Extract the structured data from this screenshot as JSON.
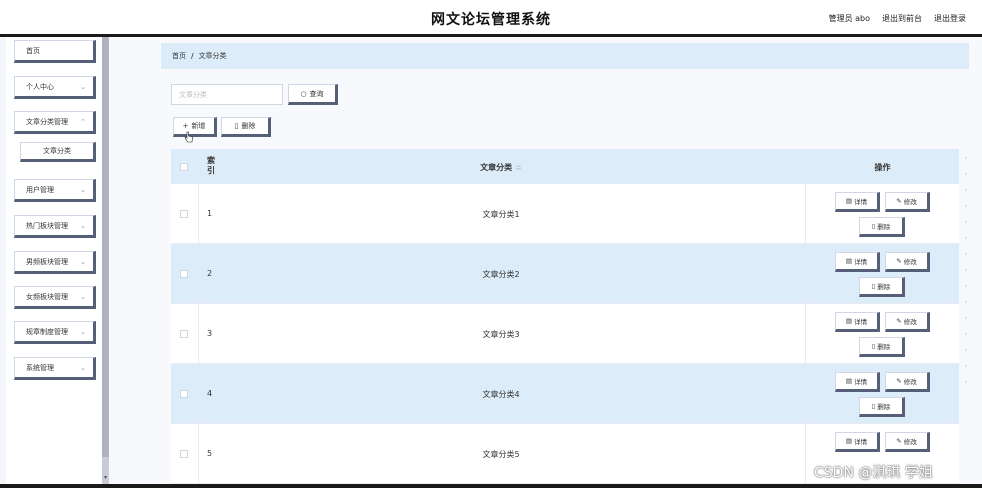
{
  "header": {
    "title": "网文论坛管理系统",
    "user_label": "管理员 abo",
    "back_label": "退出到前台",
    "logout_label": "退出登录"
  },
  "sidebar": {
    "items": [
      {
        "label": "首页"
      },
      {
        "label": "个人中心"
      },
      {
        "label": "文章分类管理"
      },
      {
        "label": "文章分类"
      },
      {
        "label": "用户管理"
      },
      {
        "label": "热门板块管理"
      },
      {
        "label": "男频板块管理"
      },
      {
        "label": "女频板块管理"
      },
      {
        "label": "规章制度管理"
      },
      {
        "label": "系统管理"
      }
    ]
  },
  "breadcrumb": {
    "home": "首页",
    "separator": "/",
    "current": "文章分类"
  },
  "search": {
    "placeholder": "文章分类",
    "button_label": "查询"
  },
  "toolbar": {
    "add_label": "新增",
    "delete_label": "删除"
  },
  "table": {
    "headers": {
      "index": "索引",
      "name": "文章分类",
      "sort_icon": "≑",
      "ops": "操作"
    },
    "rows": [
      {
        "index": "1",
        "name": "文章分类1"
      },
      {
        "index": "2",
        "name": "文章分类2"
      },
      {
        "index": "3",
        "name": "文章分类3"
      },
      {
        "index": "4",
        "name": "文章分类4"
      },
      {
        "index": "5",
        "name": "文章分类5"
      }
    ],
    "op_labels": {
      "detail": "详情",
      "edit": "修改",
      "delete": "删除"
    }
  },
  "watermark": "CSDN @淇琪 学姐",
  "colors": {
    "accent_light": "#dcecf8",
    "button_shadow": "#555f78"
  }
}
